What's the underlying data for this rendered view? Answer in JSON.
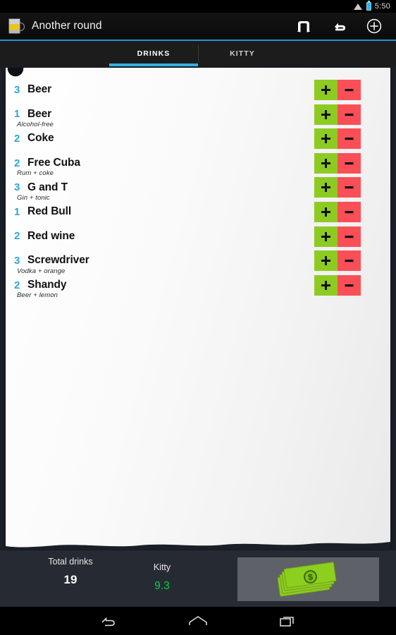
{
  "status_bar": {
    "time": "5:50",
    "wifi_icon": "wifi-icon",
    "battery_icon": "battery-icon"
  },
  "action_bar": {
    "app_icon": "beer-mug-icon",
    "title": "Another round",
    "actions": [
      {
        "name": "group-icon",
        "label": "Group"
      },
      {
        "name": "undo-icon",
        "label": "Undo"
      },
      {
        "name": "add-icon",
        "label": "Add"
      }
    ]
  },
  "tabs": [
    {
      "label": "DRINKS",
      "selected": true
    },
    {
      "label": "KITTY",
      "selected": false
    }
  ],
  "drinks": [
    {
      "qty": "3",
      "name": "Beer",
      "sub": ""
    },
    {
      "qty": "1",
      "name": "Beer",
      "sub": "Alcohol-free"
    },
    {
      "qty": "2",
      "name": "Coke",
      "sub": ""
    },
    {
      "qty": "2",
      "name": "Free Cuba",
      "sub": "Rum + coke"
    },
    {
      "qty": "3",
      "name": "G and T",
      "sub": "Gin + tonic"
    },
    {
      "qty": "1",
      "name": "Red Bull",
      "sub": ""
    },
    {
      "qty": "2",
      "name": "Red wine",
      "sub": ""
    },
    {
      "qty": "3",
      "name": "Screwdriver",
      "sub": "Vodka + orange"
    },
    {
      "qty": "2",
      "name": "Shandy",
      "sub": "Beer + lemon"
    }
  ],
  "row_controls": {
    "increment_label": "+",
    "decrement_label": "–"
  },
  "footer": {
    "total_label": "Total drinks",
    "total_value": "19",
    "kitty_label": "Kitty",
    "kitty_value": "9.3",
    "kitty_button_icon": "money-stack-icon"
  },
  "nav_bar": {
    "back_icon": "back-icon",
    "home_icon": "home-icon",
    "recents_icon": "recents-icon"
  },
  "colors": {
    "accent": "#33b5e5",
    "qty": "#2aa8d8",
    "plus": "#8ecb22",
    "minus": "#fb4f58",
    "kitty_value": "#00d24a",
    "background": "#1b1f27",
    "footer": "#262b33"
  }
}
